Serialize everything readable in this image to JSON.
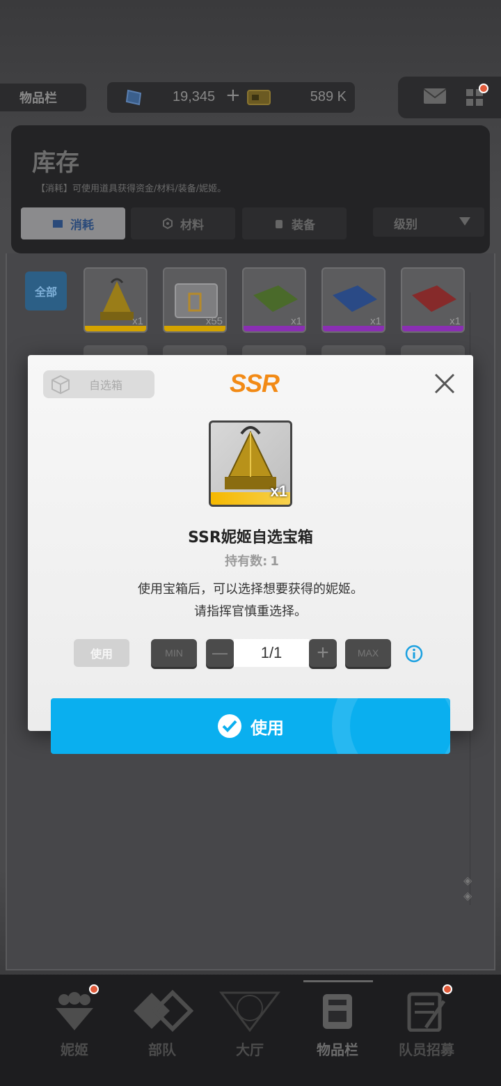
{
  "topbar": {
    "title": "物品栏",
    "gems": "19,345",
    "gems_plus": "+",
    "credits": "589 K"
  },
  "inventory": {
    "title": "库存",
    "description": "【消耗】可使用道具获得资金/材料/装备/妮姬。",
    "tabs": [
      {
        "label": "消耗",
        "icon": "box-icon"
      },
      {
        "label": "材料",
        "icon": "gear-icon"
      },
      {
        "label": "装备",
        "icon": "equipment-icon"
      }
    ],
    "sort_label": "级别",
    "filter_all": "全部",
    "items": [
      {
        "name": "ssr-select-box",
        "count": "x1",
        "rarity_color": "#d4a300"
      },
      {
        "name": "supply-crate",
        "count": "x55",
        "rarity_color": "#d4a300"
      },
      {
        "name": "green-case",
        "count": "x1",
        "rarity_color": "#8a2fb3"
      },
      {
        "name": "blue-case",
        "count": "x1",
        "rarity_color": "#8a2fb3"
      },
      {
        "name": "red-case",
        "count": "x1",
        "rarity_color": "#8a2fb3"
      }
    ]
  },
  "nav": [
    {
      "label": "妮姬",
      "icon": "nikke-icon"
    },
    {
      "label": "部队",
      "icon": "squad-icon"
    },
    {
      "label": "大厅",
      "icon": "lobby-icon"
    },
    {
      "label": "物品栏",
      "icon": "inventory-icon"
    },
    {
      "label": "队员招募",
      "icon": "recruit-icon"
    }
  ],
  "dialog": {
    "tag": "自选箱",
    "rarity": "SSR",
    "item_count": "x1",
    "item_name": "SSR妮姬自选宝箱",
    "owned_label": "持有数:",
    "owned_value": "1",
    "desc_line1": "使用宝箱后，可以选择想要获得的妮姬。",
    "desc_line2": "请指挥官慎重选择。",
    "use_small": "使用",
    "min_label": "MIN",
    "max_label": "MAX",
    "minus": "—",
    "plus": "+",
    "quantity": "1/1",
    "confirm_label": "使用"
  },
  "colors": {
    "accent": "#0aafef",
    "ssr": "#f28a15"
  }
}
